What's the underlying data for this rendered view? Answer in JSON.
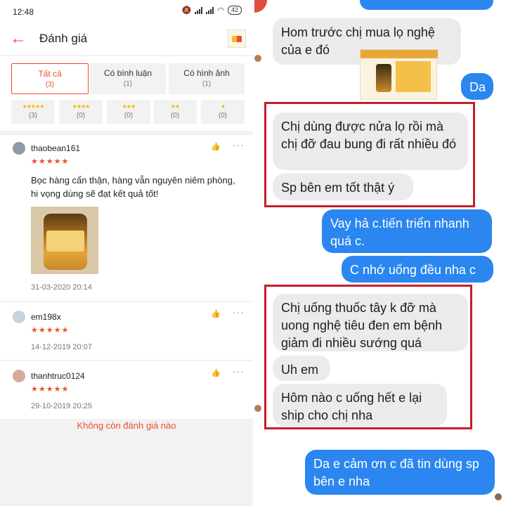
{
  "status_bar": {
    "time": "12:48",
    "battery": "42"
  },
  "app_bar": {
    "title": "Đánh giá"
  },
  "filter_tabs": [
    {
      "label": "Tất cả",
      "count": "(3)"
    },
    {
      "label": "Có bình luận",
      "count": "(1)"
    },
    {
      "label": "Có hình ảnh",
      "count": "(1)"
    }
  ],
  "star_filters": [
    {
      "stars": "★★★★★",
      "count": "(3)"
    },
    {
      "stars": "★★★★",
      "count": "(0)"
    },
    {
      "stars": "★★★",
      "count": "(0)"
    },
    {
      "stars": "★★",
      "count": "(0)"
    },
    {
      "stars": "★",
      "count": "(0)"
    }
  ],
  "reviews": [
    {
      "user": "thaobean161",
      "stars": "★★★★★",
      "rating": 5,
      "text": "Bọc hàng cẩn thận, hàng vẫn nguyên niêm phòng, hi vọng dùng sẽ đạt kết quả tốt!",
      "date": "31-03-2020 20:14"
    },
    {
      "user": "em198x",
      "stars": "★★★★★",
      "rating": 5,
      "date": "14-12-2019 20:07"
    },
    {
      "user": "thanhtruc0124",
      "stars": "★★★★★",
      "rating": 5,
      "date": "29-10-2019 20:25"
    }
  ],
  "no_more_text": "Không còn đánh giá nào",
  "chat": {
    "messages": [
      {
        "from": "in",
        "text": "Hom trước chị mua lọ nghệ của e đó"
      },
      {
        "from": "out",
        "text": "Da"
      },
      {
        "from": "in",
        "text": "Chị dùng được nửa lọ rồi mà chị đỡ đau bung đi rất nhiều đó"
      },
      {
        "from": "in",
        "text": "Sp bên em tốt thật ý"
      },
      {
        "from": "out",
        "text": "Vay hả c.tiến triển nhanh quá c."
      },
      {
        "from": "out",
        "text": "C nhớ uống đều nha c"
      },
      {
        "from": "in",
        "text": "Chị uống thuốc tây k đỡ mà uong nghệ tiêu đen em bệnh giảm đi nhiều sướng quá"
      },
      {
        "from": "in",
        "text": "Uh em"
      },
      {
        "from": "in",
        "text": "Hôm nào c uống hết e lại ship cho chị nha"
      },
      {
        "from": "out",
        "text": "Da e cảm ơn c đã tin dùng sp bên e nha"
      }
    ],
    "colors": {
      "incoming": "#ebebeb",
      "outgoing": "#2b86f0",
      "highlight": "#c4202b"
    }
  },
  "colors": {
    "accent": "#ee4d2d",
    "star": "#ee4d2d"
  },
  "icons": [
    "back-arrow-icon",
    "shop-icon",
    "like-icon",
    "more-icon",
    "avatar-icon"
  ]
}
